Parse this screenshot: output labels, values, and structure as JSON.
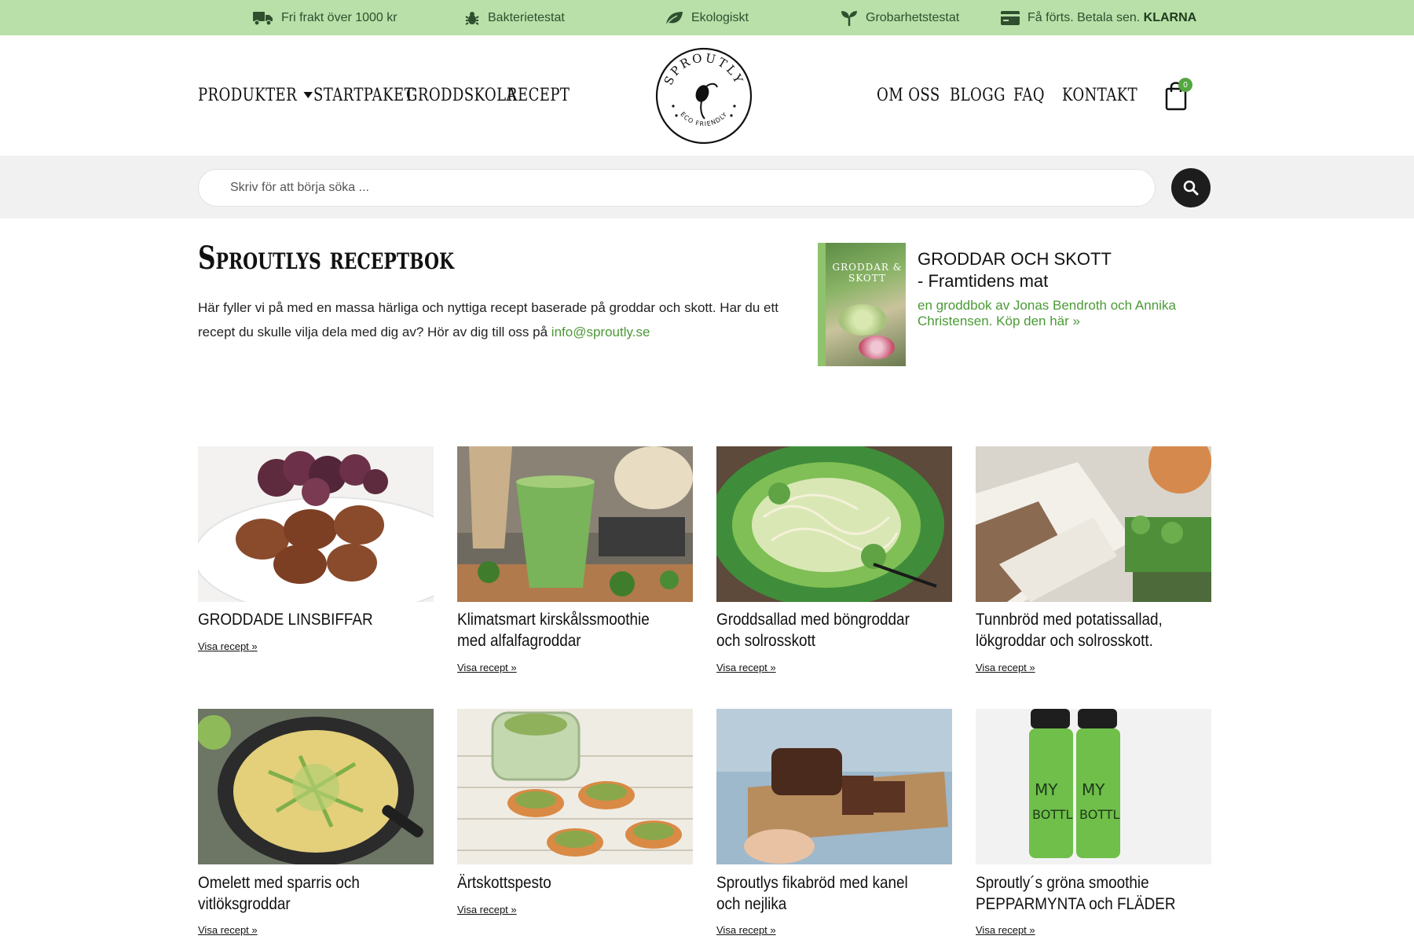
{
  "topbar": {
    "items": [
      {
        "icon": "truck-icon",
        "label": "Fri frakt över 1000 kr"
      },
      {
        "icon": "bug-icon",
        "label": "Bakterietestat"
      },
      {
        "icon": "leaf-icon",
        "label": "Ekologiskt"
      },
      {
        "icon": "seedling-icon",
        "label": "Grobarhetstestat"
      },
      {
        "icon": "credit-card-icon",
        "label": "Få förts. Betala sen.",
        "strong": "KLARNA"
      }
    ]
  },
  "nav": {
    "left": [
      {
        "label": "PRODUKTER",
        "has_dropdown": true
      },
      {
        "label": "STARTPAKET"
      },
      {
        "label": "GRODDSKOLA"
      },
      {
        "label": "RECEPT"
      }
    ],
    "right": [
      {
        "label": "OM OSS"
      },
      {
        "label": "BLOGG"
      },
      {
        "label": "FAQ"
      },
      {
        "label": "KONTAKT"
      }
    ],
    "logo": {
      "top_text": "SPROUTLY",
      "bottom_text": "ECO FRIENDLY"
    },
    "cart_count": "0"
  },
  "search": {
    "placeholder": "Skriv för att börja söka ..."
  },
  "intro": {
    "title": "Sproutlys receptbok",
    "text": "Här fyller vi på med en massa härliga och nyttiga recept baserade på groddar och skott. Har du ett recept du skulle vilja dela med dig av? Hör av dig till oss på ",
    "email": "info@sproutly.se"
  },
  "book": {
    "cover_title": "GRODDAR & SKOTT",
    "title_line1": "GRODDAR OCH SKOTT",
    "title_line2": "- Framtidens mat",
    "subtitle": "en groddbok av Jonas Bendroth och Annika Christensen. Köp den här »"
  },
  "recipes": [
    {
      "title": "GRODDADE LINSBIFFAR",
      "link": "Visa recept »"
    },
    {
      "title": "Klimatsmart kirskålssmoothie med alfalfagroddar",
      "link": "Visa recept »"
    },
    {
      "title": "Groddsallad med böngroddar och solrosskott",
      "link": "Visa recept »"
    },
    {
      "title": "Tunnbröd med potatissallad, lökgroddar och solrosskott.",
      "link": "Visa recept »"
    },
    {
      "title": "Omelett med sparris och vitlöksgroddar",
      "link": "Visa recept »"
    },
    {
      "title": "Ärtskottspesto",
      "link": "Visa recept »"
    },
    {
      "title": "Sproutlys fikabröd med kanel och nejlika",
      "link": "Visa recept »"
    },
    {
      "title": "Sproutly´s gröna smoothie PEPPARMYNTA och FLÄDER",
      "link": "Visa recept »"
    }
  ],
  "colors": {
    "topbar": "#b8e0a8",
    "accent_green": "#4a9a35",
    "search_band": "#f1f1f1",
    "dark": "#1d1d1d"
  }
}
